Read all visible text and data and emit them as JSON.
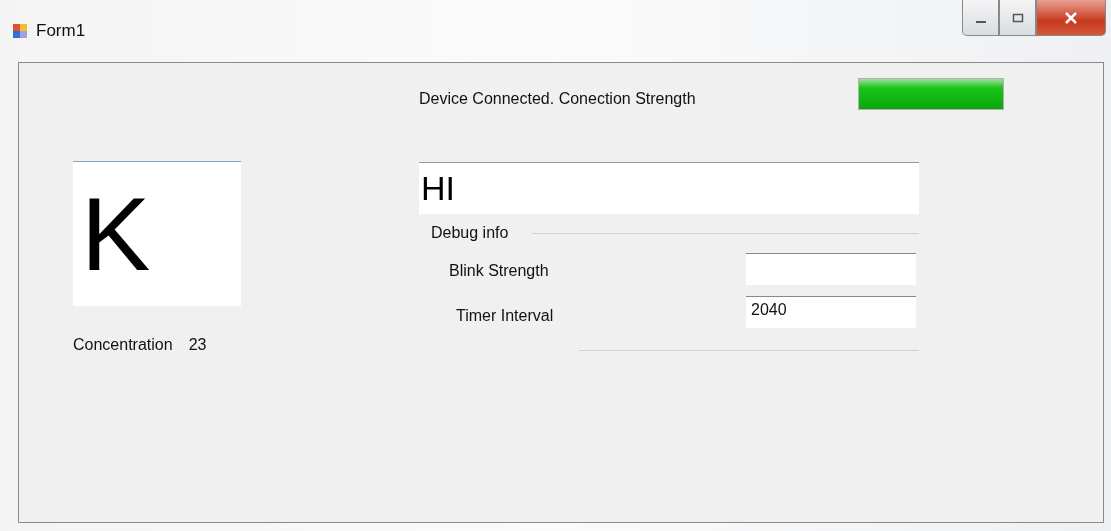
{
  "window": {
    "title": "Form1"
  },
  "status": {
    "label": "Device Connected. Conection Strength",
    "level": 1
  },
  "letter_display": {
    "value": "K"
  },
  "concentration": {
    "label": "Concentration",
    "value": "23"
  },
  "message_field": {
    "value": "HI"
  },
  "debug_group": {
    "title": "Debug info",
    "fields": [
      {
        "label": "Blink Strength"
      },
      {
        "label": "Timer Interval",
        "value": "2040"
      }
    ]
  }
}
